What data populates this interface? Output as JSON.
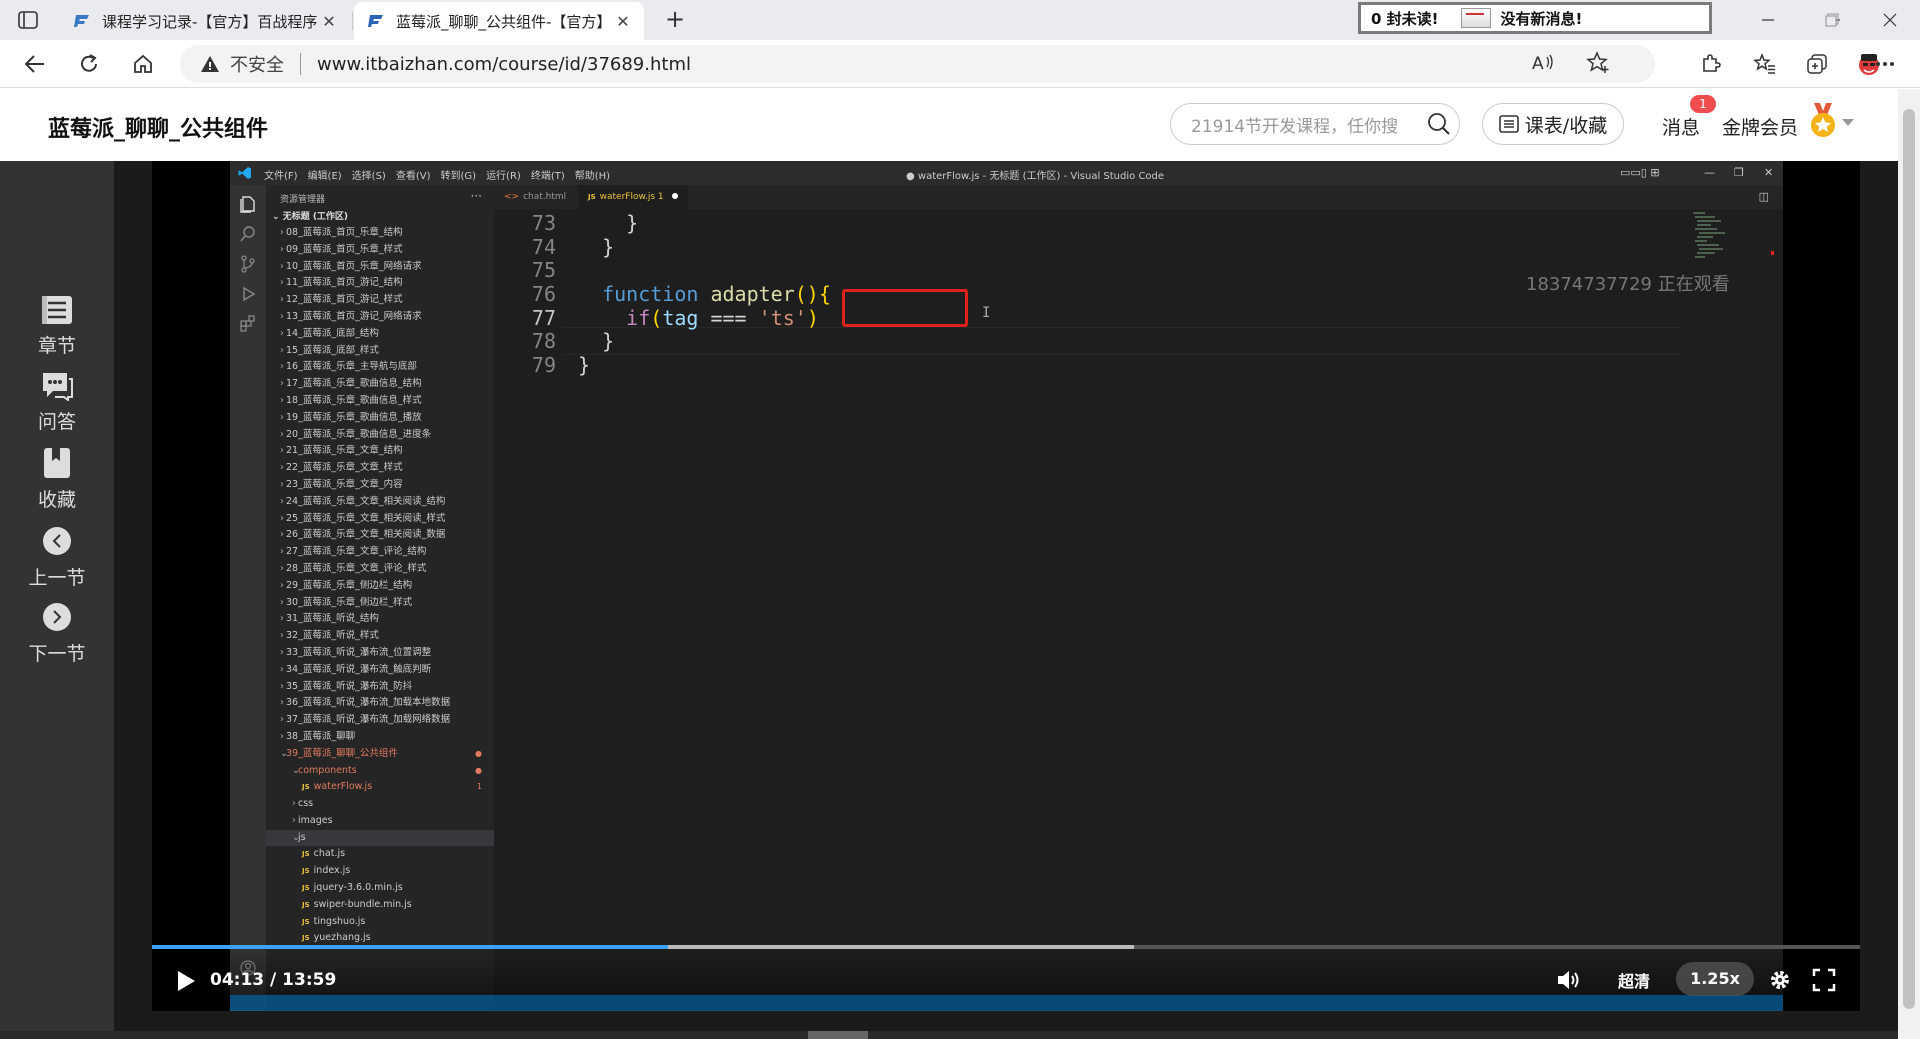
{
  "browser": {
    "tabs": [
      {
        "title": "课程学习记录-【官方】百战程序",
        "active": false
      },
      {
        "title": "蓝莓派_聊聊_公共组件-【官方】",
        "active": true
      }
    ],
    "notice": {
      "unread": "0 封未读!",
      "message": "没有新消息!"
    },
    "address": {
      "security": "不安全",
      "url": "www.itbaizhan.com/course/id/37689.html"
    }
  },
  "site": {
    "course_title": "蓝莓派_聊聊_公共组件",
    "search_placeholder": "21914节开发课程，任你搜",
    "schedule_label": "课表/收藏",
    "messages_label": "消息",
    "messages_badge": "1",
    "member_label": "金牌会员"
  },
  "sidebar": {
    "items": [
      {
        "label": "章节",
        "icon": "chapter-icon"
      },
      {
        "label": "问答",
        "icon": "qa-icon"
      },
      {
        "label": "收藏",
        "icon": "bookmark-icon"
      },
      {
        "label": "上一节",
        "icon": "prev-icon"
      },
      {
        "label": "下一节",
        "icon": "next-icon"
      }
    ]
  },
  "vscode": {
    "menu": [
      "文件(F)",
      "编辑(E)",
      "选择(S)",
      "查看(V)",
      "转到(G)",
      "运行(R)",
      "终端(T)",
      "帮助(H)"
    ],
    "window_title": "● waterFlow.js - 无标题 (工作区) - Visual Studio Code",
    "explorer_header": "资源管理器",
    "workspace": "无标题 (工作区)",
    "tree": [
      "08_蓝莓派_首页_乐章_结构",
      "09_蓝莓派_首页_乐章_样式",
      "10_蓝莓派_首页_乐章_网络请求",
      "11_蓝莓派_首页_游记_结构",
      "12_蓝莓派_首页_游记_样式",
      "13_蓝莓派_首页_游记_网络请求",
      "14_蓝莓派_底部_结构",
      "15_蓝莓派_底部_样式",
      "16_蓝莓派_乐章_主导航与底部",
      "17_蓝莓派_乐章_歌曲信息_结构",
      "18_蓝莓派_乐章_歌曲信息_样式",
      "19_蓝莓派_乐章_歌曲信息_播放",
      "20_蓝莓派_乐章_歌曲信息_进度条",
      "21_蓝莓派_乐章_文章_结构",
      "22_蓝莓派_乐章_文章_样式",
      "23_蓝莓派_乐章_文章_内容",
      "24_蓝莓派_乐章_文章_相关阅读_结构",
      "25_蓝莓派_乐章_文章_相关阅读_样式",
      "26_蓝莓派_乐章_文章_相关阅读_数据",
      "27_蓝莓派_乐章_文章_评论_结构",
      "28_蓝莓派_乐章_文章_评论_样式",
      "29_蓝莓派_乐章_侧边栏_结构",
      "30_蓝莓派_乐章_侧边栏_样式",
      "31_蓝莓派_听说_结构",
      "32_蓝莓派_听说_样式",
      "33_蓝莓派_听说_瀑布流_位置调整",
      "34_蓝莓派_听说_瀑布流_触底判断",
      "35_蓝莓派_听说_瀑布流_防抖",
      "36_蓝莓派_听说_瀑布流_加载本地数据",
      "37_蓝莓派_听说_瀑布流_加载网络数据",
      "38_蓝莓派_聊聊"
    ],
    "open_folder": "39_蓝莓派_聊聊_公共组件",
    "components_folder": "components",
    "components_file": "waterFlow.js",
    "components_file_badge": "1",
    "other_folders": [
      "css",
      "images"
    ],
    "js_folder": "js",
    "js_files": [
      "chat.js",
      "index.js",
      "jquery-3.6.0.min.js",
      "swiper-bundle.min.js",
      "tingshuo.js",
      "yuezhang.js"
    ],
    "editor_tabs": [
      {
        "label": "chat.html"
      },
      {
        "label": "waterFlow.js 1"
      }
    ],
    "lines": [
      {
        "n": "73",
        "text": "    }"
      },
      {
        "n": "74",
        "text": "  }"
      },
      {
        "n": "75",
        "text": ""
      },
      {
        "n": "76",
        "kw": "function",
        "fn": "adapter",
        "rest": "(){"
      },
      {
        "n": "77",
        "ctl": "if",
        "var": "tag",
        "op": " === ",
        "str": "'ts'"
      },
      {
        "n": "78",
        "text": "  }"
      },
      {
        "n": "79",
        "text": "}"
      }
    ],
    "watermark": "18374737729 正在观看"
  },
  "player": {
    "time": "04:13 / 13:59",
    "progress": 0.302,
    "quality": "超清",
    "speed": "1.25x"
  }
}
